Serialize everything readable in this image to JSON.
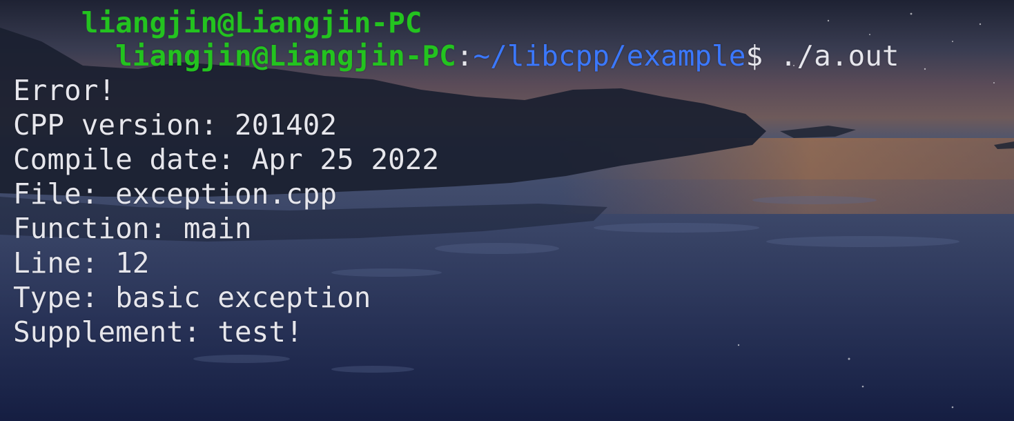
{
  "terminal": {
    "prompt": {
      "user_host": "liangjin@Liangjin-PC",
      "colon": ":",
      "path": "~/libcpp/example",
      "dollar": "$",
      "command": " ./a.out"
    },
    "output_lines": [
      "",
      "Error!",
      "CPP version: 201402",
      "Compile date: Apr 25 2022",
      "File: exception.cpp",
      "Function: main",
      "Line: 12",
      "Type: basic exception",
      "Supplement: test!"
    ]
  },
  "colors": {
    "user_host": "#23c31f",
    "path": "#3b78ff",
    "text": "#e6e6ec"
  }
}
